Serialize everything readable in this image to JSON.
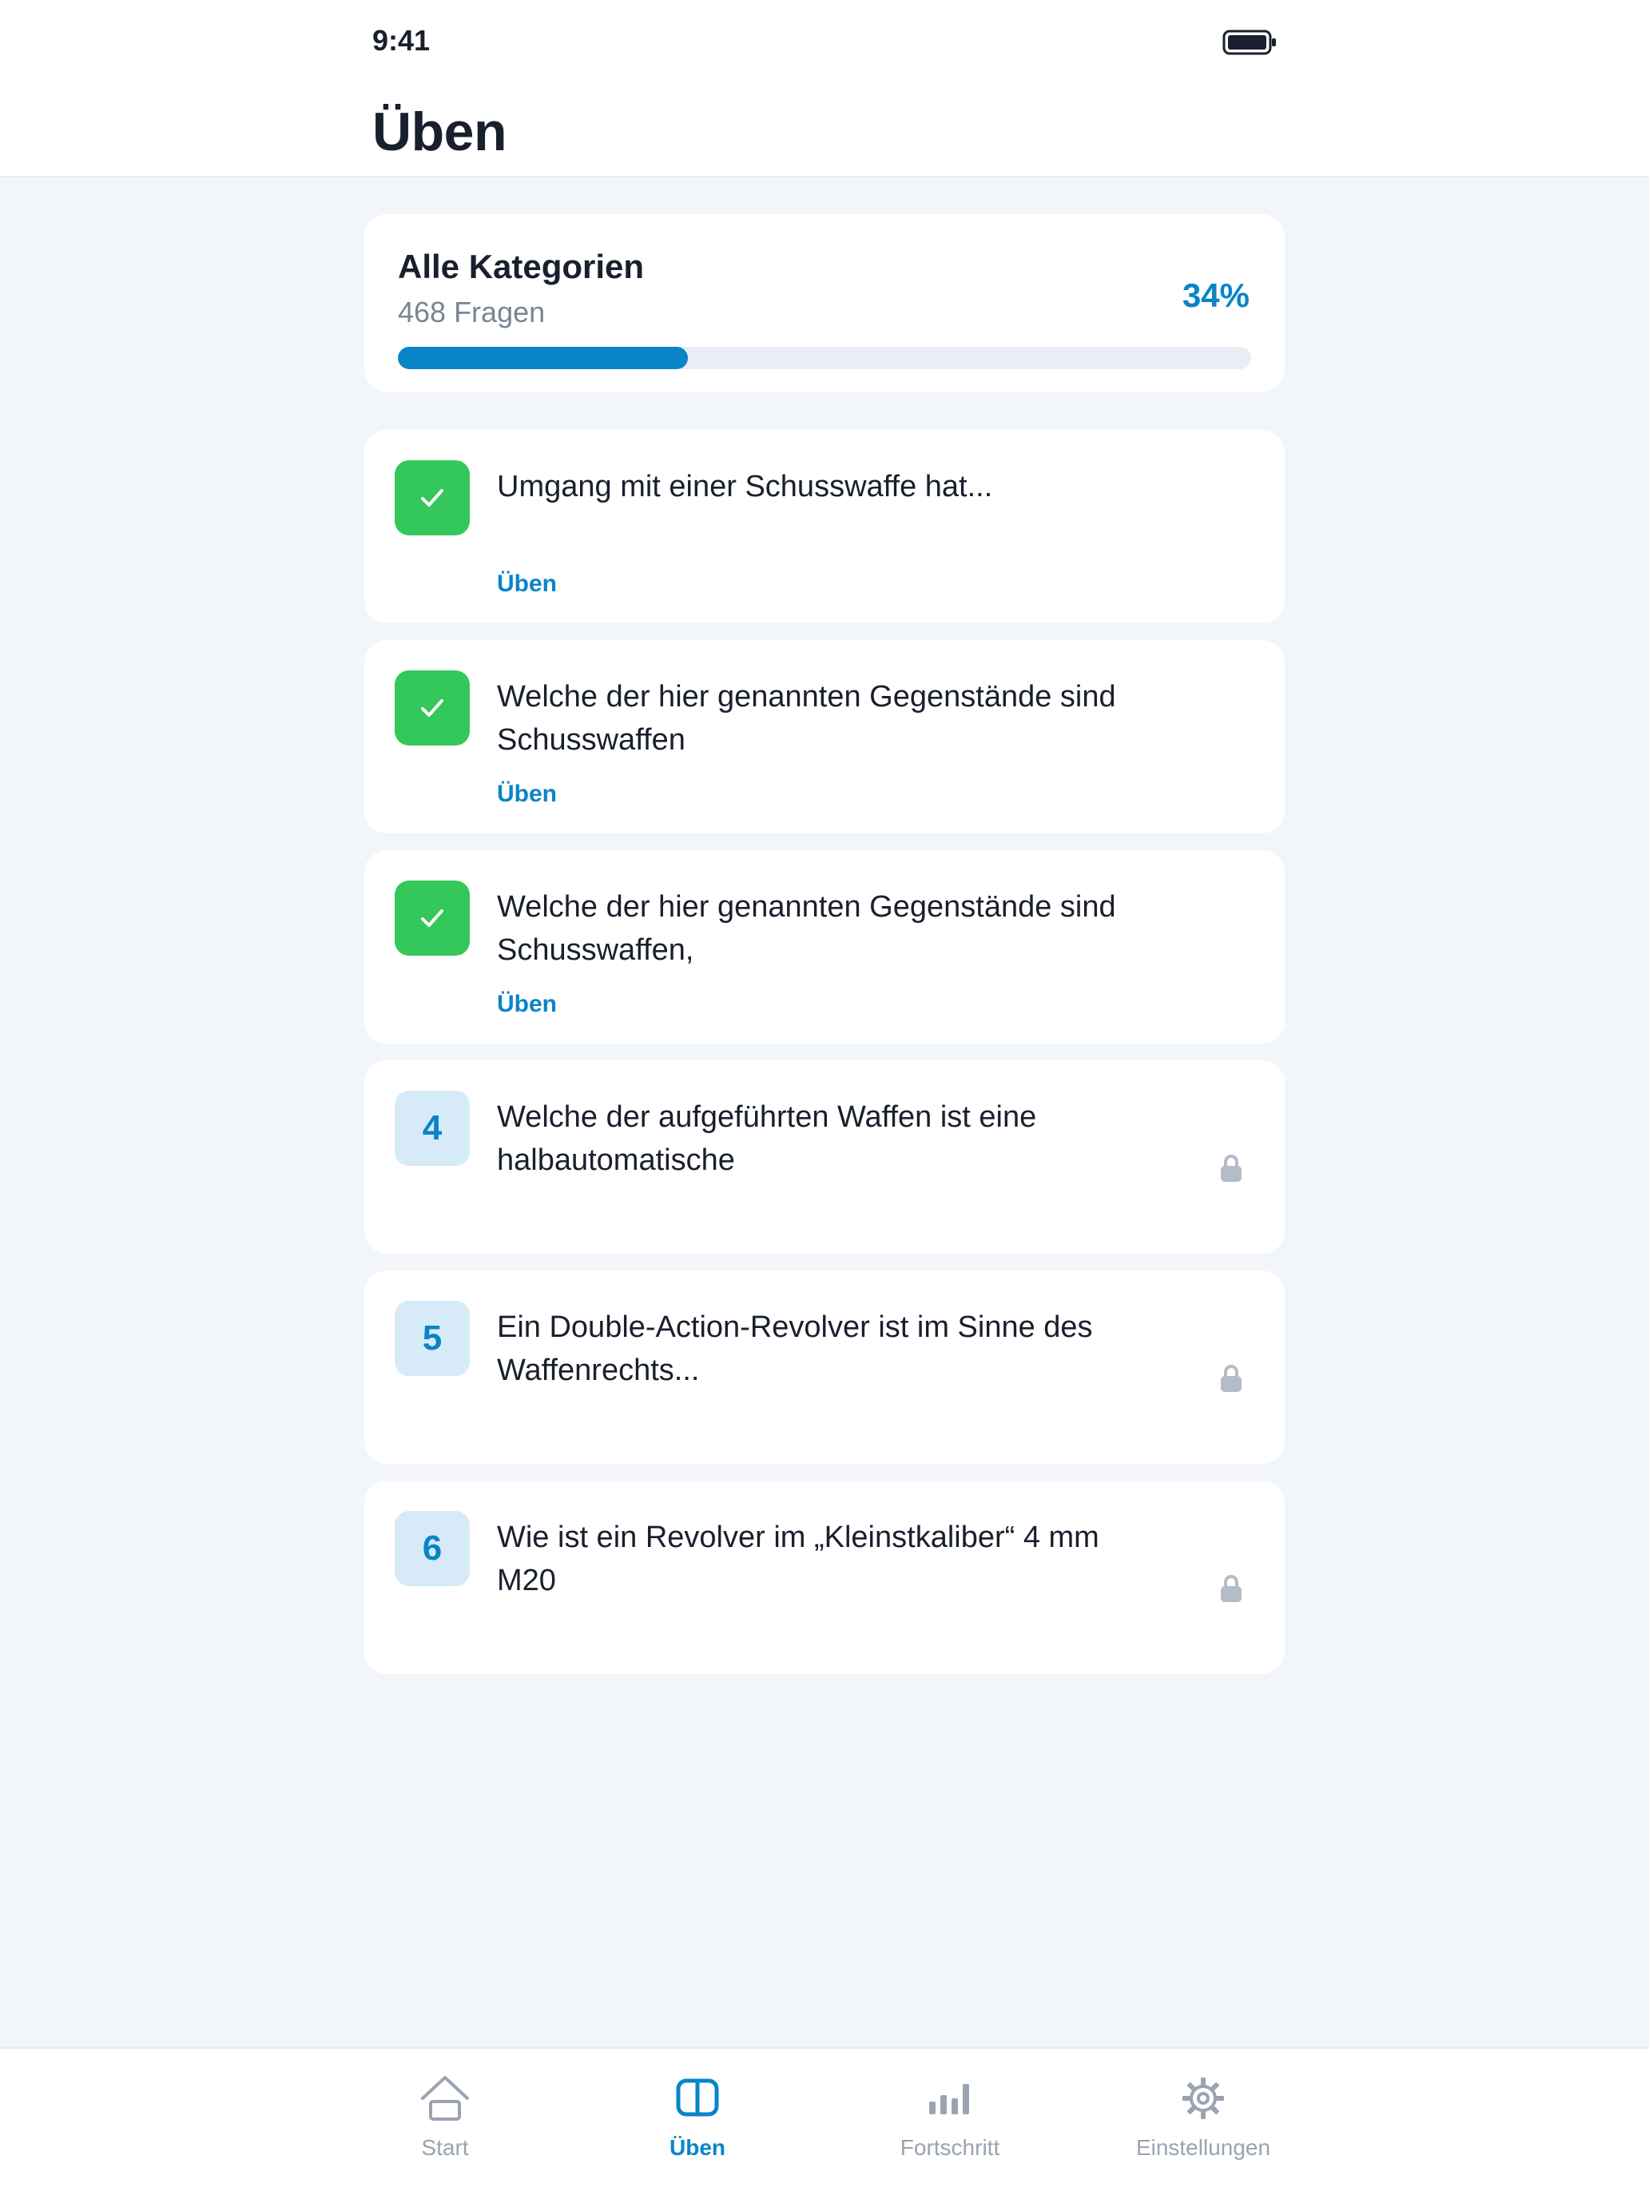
{
  "status_bar": {
    "time": "9:41"
  },
  "header": {
    "title": "Üben"
  },
  "summary": {
    "title": "Alle Kategorien",
    "subtitle": "468 Fragen",
    "percent_label": "34%",
    "progress": 0.34
  },
  "questions": [
    {
      "badge": "",
      "state": "done",
      "text": "Umgang mit einer Schusswaffe hat...",
      "action": "Üben"
    },
    {
      "badge": "",
      "state": "done",
      "text": "Welche der hier genannten Gegenstände sind Schusswaffen",
      "action": "Üben"
    },
    {
      "badge": "",
      "state": "done",
      "text": "Welche der hier genannten Gegenstände sind Schusswaffen,",
      "action": "Üben"
    },
    {
      "badge": "4",
      "state": "locked",
      "text": "Welche der aufgeführten Waffen ist eine halbautomatische",
      "action": ""
    },
    {
      "badge": "5",
      "state": "locked",
      "text": "Ein Double-Action-Revolver ist im Sinne des Waffenrechts...",
      "action": ""
    },
    {
      "badge": "6",
      "state": "locked",
      "text": "Wie ist ein Revolver im „Kleinstkaliber“ 4 mm M20",
      "action": ""
    }
  ],
  "tabs": [
    {
      "label": "Start",
      "icon": "home-icon",
      "active": false
    },
    {
      "label": "Üben",
      "icon": "book-icon",
      "active": true
    },
    {
      "label": "Fortschritt",
      "icon": "bar-chart-icon",
      "active": false
    },
    {
      "label": "Einstellungen",
      "icon": "gear-icon",
      "active": false
    }
  ],
  "colors": {
    "accent": "#0a84c8",
    "success": "#34c759",
    "inactive": "#9aa3b1",
    "background": "#f2f5f9"
  }
}
